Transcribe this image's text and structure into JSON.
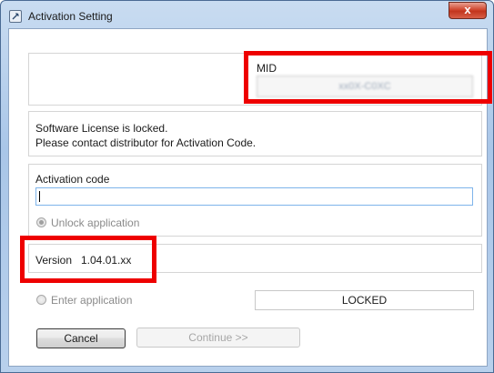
{
  "window": {
    "title": "Activation Setting",
    "close_label": "x",
    "icon": "wrench-icon"
  },
  "mid": {
    "label": "MID",
    "value": "xx0X-C0XC"
  },
  "license": {
    "line1": "Software License is locked.",
    "line2": "Please contact distributor for Activation Code."
  },
  "activation": {
    "label": "Activation code",
    "value": "",
    "unlock_label": "Unlock application"
  },
  "version": {
    "label": "Version",
    "value": "1.04.01.xx"
  },
  "enter": {
    "label": "Enter application",
    "status": "LOCKED"
  },
  "buttons": {
    "cancel": "Cancel",
    "continue": "Continue >>"
  },
  "colors": {
    "highlight": "#ee0000",
    "title_bar": "#b8d0ec",
    "close_button": "#c2351d"
  }
}
